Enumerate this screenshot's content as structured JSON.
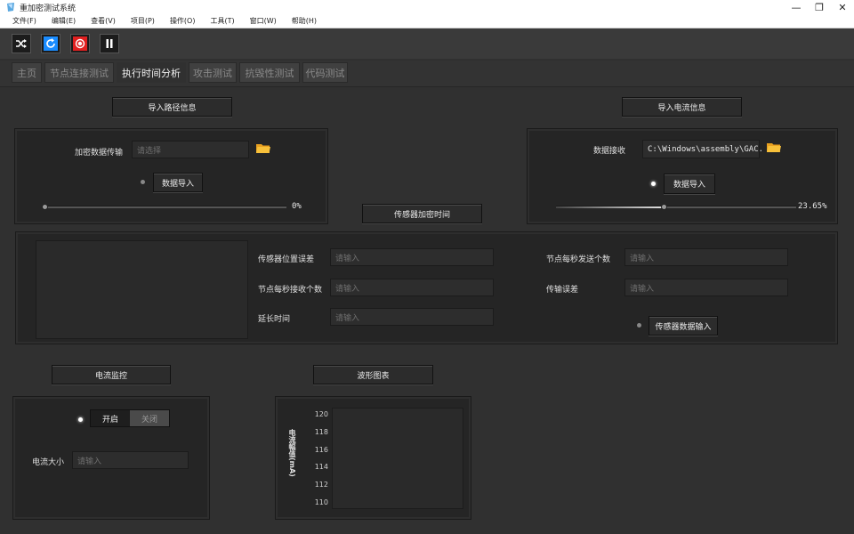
{
  "window": {
    "title": "重加密测试系统",
    "controls": [
      "—",
      "❐",
      "✕"
    ]
  },
  "menu": [
    "文件(F)",
    "编辑(E)",
    "查看(V)",
    "项目(P)",
    "操作(O)",
    "工具(T)",
    "窗口(W)",
    "帮助(H)"
  ],
  "toolbar": {
    "icons": [
      "shuffle-icon",
      "refresh-icon",
      "record-icon",
      "pause-icon"
    ],
    "colors": {
      "refresh": "#1a8cff",
      "record": "#e02020"
    }
  },
  "tabs": [
    "主页",
    "节点连接测试",
    "执行时间分析",
    "攻击测试",
    "抗毁性测试",
    "代码测试"
  ],
  "active_tab": "执行时间分析",
  "path_section": {
    "button": "导入路径信息",
    "label": "加密数据传输",
    "placeholder": "请选择",
    "import_button": "数据导入",
    "progress_text": "0%",
    "progress": 0
  },
  "current_section": {
    "button": "导入电流信息",
    "label": "数据接收",
    "value": "C:\\Windows\\assembly\\GAC.",
    "import_button": "数据导入",
    "progress_text": "23.65%",
    "progress": 0.2365
  },
  "sensor_time_button": "传感器加密时间",
  "sensor_form": {
    "fields": [
      {
        "label": "传感器位置误差",
        "placeholder": "请输入"
      },
      {
        "label": "节点每秒接收个数",
        "placeholder": "请输入"
      },
      {
        "label": "延长时间",
        "placeholder": "请输入"
      },
      {
        "label": "节点每秒发送个数",
        "placeholder": "请输入"
      },
      {
        "label": "传输误差",
        "placeholder": "请输入"
      }
    ],
    "input_button": "传感器数据输入"
  },
  "monitor": {
    "button": "电流监控",
    "on_label": "开启",
    "off_label": "关闭",
    "size_label": "电流大小",
    "placeholder": "请输入"
  },
  "waveform": {
    "button": "波形图表"
  },
  "chart_data": {
    "type": "line",
    "ylabel": "电流幅值(mA)",
    "yticks": [
      "120",
      "118",
      "116",
      "114",
      "112",
      "110"
    ],
    "ylim": [
      110,
      120
    ],
    "series": []
  }
}
